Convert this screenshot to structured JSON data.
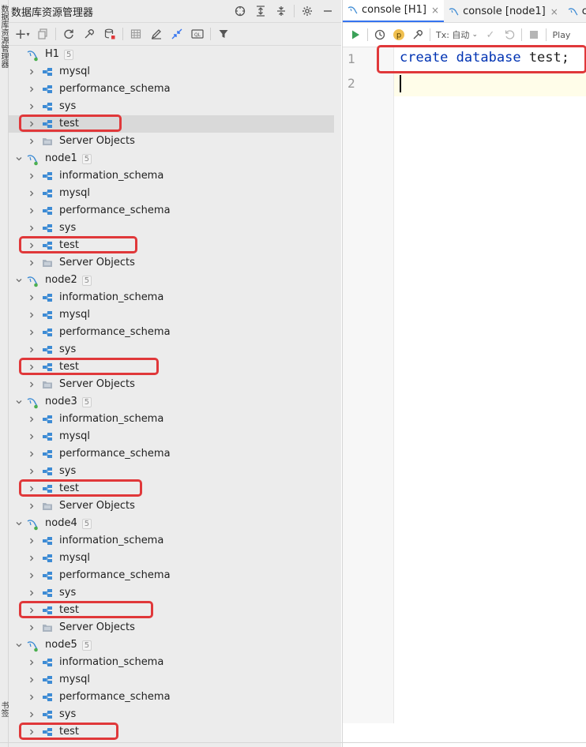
{
  "explorer": {
    "title": "数据库资源管理器",
    "side_labels": {
      "top": "数据库资源管理器",
      "bottom": "书签"
    }
  },
  "tree": [
    {
      "label": "H1",
      "count": "5",
      "type": "host"
    },
    {
      "label": "mysql",
      "type": "schema"
    },
    {
      "label": "performance_schema",
      "type": "schema"
    },
    {
      "label": "sys",
      "type": "schema"
    },
    {
      "label": "test",
      "type": "schema",
      "highlight": true,
      "selected": true
    },
    {
      "label": "Server Objects",
      "type": "server"
    },
    {
      "label": "node1",
      "count": "5",
      "type": "host"
    },
    {
      "label": "information_schema",
      "type": "schema"
    },
    {
      "label": "mysql",
      "type": "schema"
    },
    {
      "label": "performance_schema",
      "type": "schema"
    },
    {
      "label": "sys",
      "type": "schema"
    },
    {
      "label": "test",
      "type": "schema",
      "highlight": true
    },
    {
      "label": "Server Objects",
      "type": "server"
    },
    {
      "label": "node2",
      "count": "5",
      "type": "host"
    },
    {
      "label": "information_schema",
      "type": "schema"
    },
    {
      "label": "mysql",
      "type": "schema"
    },
    {
      "label": "performance_schema",
      "type": "schema"
    },
    {
      "label": "sys",
      "type": "schema"
    },
    {
      "label": "test",
      "type": "schema",
      "highlight": true
    },
    {
      "label": "Server Objects",
      "type": "server"
    },
    {
      "label": "node3",
      "count": "5",
      "type": "host"
    },
    {
      "label": "information_schema",
      "type": "schema"
    },
    {
      "label": "mysql",
      "type": "schema"
    },
    {
      "label": "performance_schema",
      "type": "schema"
    },
    {
      "label": "sys",
      "type": "schema"
    },
    {
      "label": "test",
      "type": "schema",
      "highlight": true
    },
    {
      "label": "Server Objects",
      "type": "server"
    },
    {
      "label": "node4",
      "count": "5",
      "type": "host"
    },
    {
      "label": "information_schema",
      "type": "schema"
    },
    {
      "label": "mysql",
      "type": "schema"
    },
    {
      "label": "performance_schema",
      "type": "schema"
    },
    {
      "label": "sys",
      "type": "schema"
    },
    {
      "label": "test",
      "type": "schema",
      "highlight": true
    },
    {
      "label": "Server Objects",
      "type": "server"
    },
    {
      "label": "node5",
      "count": "5",
      "type": "host"
    },
    {
      "label": "information_schema",
      "type": "schema"
    },
    {
      "label": "mysql",
      "type": "schema"
    },
    {
      "label": "performance_schema",
      "type": "schema"
    },
    {
      "label": "sys",
      "type": "schema"
    },
    {
      "label": "test",
      "type": "schema",
      "highlight": true
    }
  ],
  "editor": {
    "tabs": [
      {
        "label": "console [H1]",
        "active": true
      },
      {
        "label": "console [node1]",
        "active": false
      },
      {
        "label": "co",
        "active": false
      }
    ],
    "tx_label": "Tx: 自动",
    "playground_label": "Play",
    "line_numbers": [
      "1",
      "2"
    ],
    "code": {
      "kw1": "create",
      "kw2": "database",
      "ident": "test;"
    }
  },
  "colors": {
    "highlight": "#e0383a",
    "keyword": "#0033b3",
    "schema_icon": "#3d8bd4",
    "accent": "#3574f0"
  }
}
